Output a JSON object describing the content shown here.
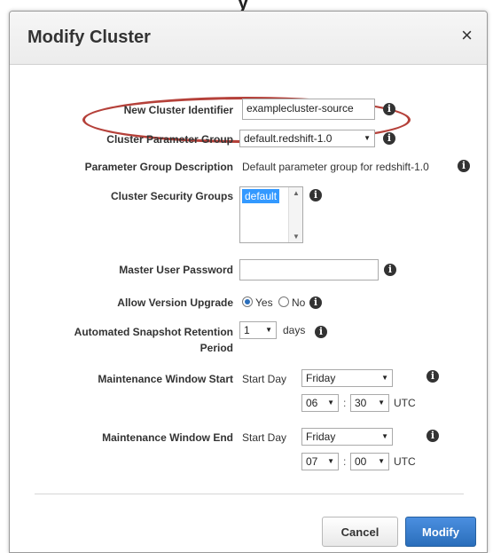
{
  "background": {
    "label": "y"
  },
  "dialog": {
    "title": "Modify Cluster",
    "close_symbol": "×"
  },
  "fields": {
    "cluster_identifier": {
      "label": "New Cluster Identifier",
      "value": "examplecluster-source"
    },
    "parameter_group": {
      "label": "Cluster Parameter Group",
      "value": "default.redshift-1.0"
    },
    "parameter_group_description": {
      "label": "Parameter Group Description",
      "value": "Default parameter group for redshift-1.0"
    },
    "security_groups": {
      "label": "Cluster Security Groups",
      "selected": "default"
    },
    "master_password": {
      "label": "Master User Password",
      "value": ""
    },
    "version_upgrade": {
      "label": "Allow Version Upgrade",
      "yes_label": "Yes",
      "no_label": "No",
      "selected": "Yes"
    },
    "snapshot_retention": {
      "label_line1": "Automated Snapshot Retention",
      "label_line2": "Period",
      "value": "1",
      "unit": "days"
    },
    "maint_start": {
      "label": "Maintenance Window Start",
      "day_label": "Start Day",
      "day": "Friday",
      "hour": "06",
      "minute": "30",
      "tz": "UTC"
    },
    "maint_end": {
      "label": "Maintenance Window End",
      "day_label": "Start Day",
      "day": "Friday",
      "hour": "07",
      "minute": "00",
      "tz": "UTC"
    }
  },
  "info_glyph": "i",
  "colon": ":",
  "buttons": {
    "cancel": "Cancel",
    "modify": "Modify"
  },
  "colors": {
    "primary": "#2a6ebb",
    "highlight_ring": "#b5413a",
    "selection": "#3399ff"
  }
}
